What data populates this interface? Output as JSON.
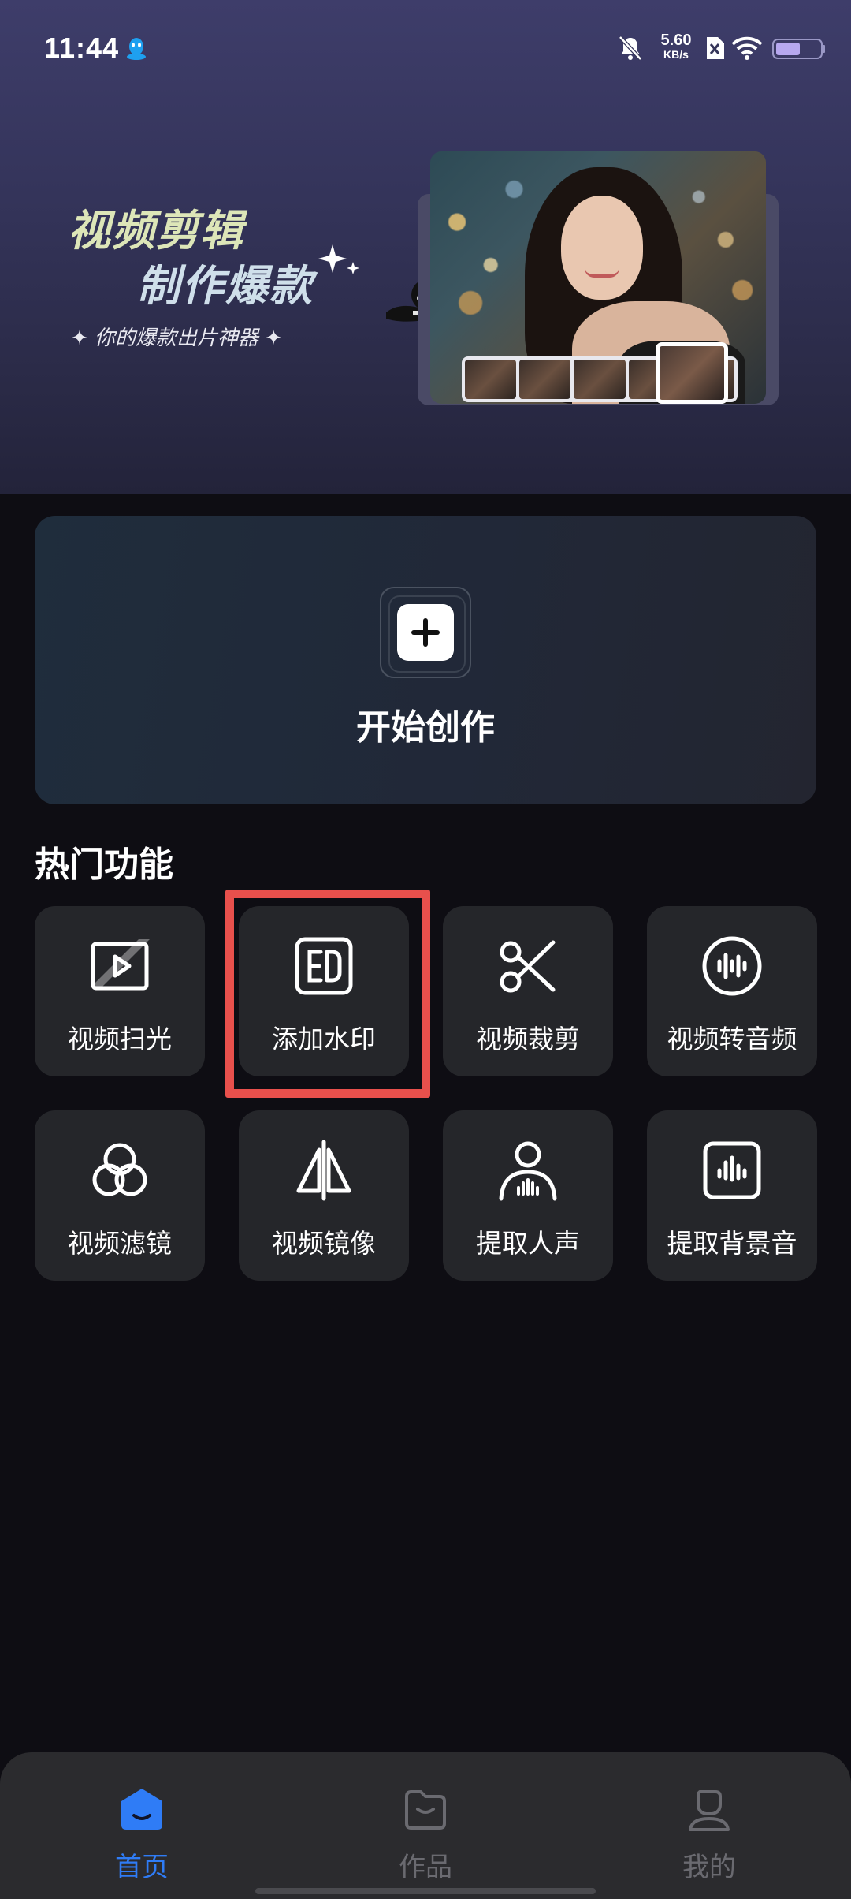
{
  "status_bar": {
    "time": "11:44",
    "net_speed_value": "5.60",
    "net_speed_unit": "KB/s"
  },
  "banner": {
    "title_line1": "视频剪辑",
    "title_line2": "制作爆款",
    "subtitle": "✦ 你的爆款出片神器 ✦"
  },
  "start_card": {
    "label": "开始创作"
  },
  "hot_features": {
    "title": "热门功能",
    "items": [
      {
        "label": "视频扫光",
        "icon": "video-scan-icon"
      },
      {
        "label": "添加水印",
        "icon": "watermark-icon"
      },
      {
        "label": "视频裁剪",
        "icon": "scissors-icon"
      },
      {
        "label": "视频转音频",
        "icon": "audio-wave-circle-icon"
      },
      {
        "label": "视频滤镜",
        "icon": "filter-circles-icon"
      },
      {
        "label": "视频镜像",
        "icon": "mirror-icon"
      },
      {
        "label": "提取人声",
        "icon": "voice-person-icon"
      },
      {
        "label": "提取背景音",
        "icon": "audio-box-icon"
      }
    ]
  },
  "bottom_nav": {
    "items": [
      {
        "label": "首页",
        "icon": "home-icon",
        "active": true
      },
      {
        "label": "作品",
        "icon": "folder-icon",
        "active": false
      },
      {
        "label": "我的",
        "icon": "profile-icon",
        "active": false
      }
    ]
  },
  "colors": {
    "accent": "#2f7cf6",
    "highlight_border": "#e8504c",
    "background": "#0e0d13",
    "tile": "#25262a"
  }
}
